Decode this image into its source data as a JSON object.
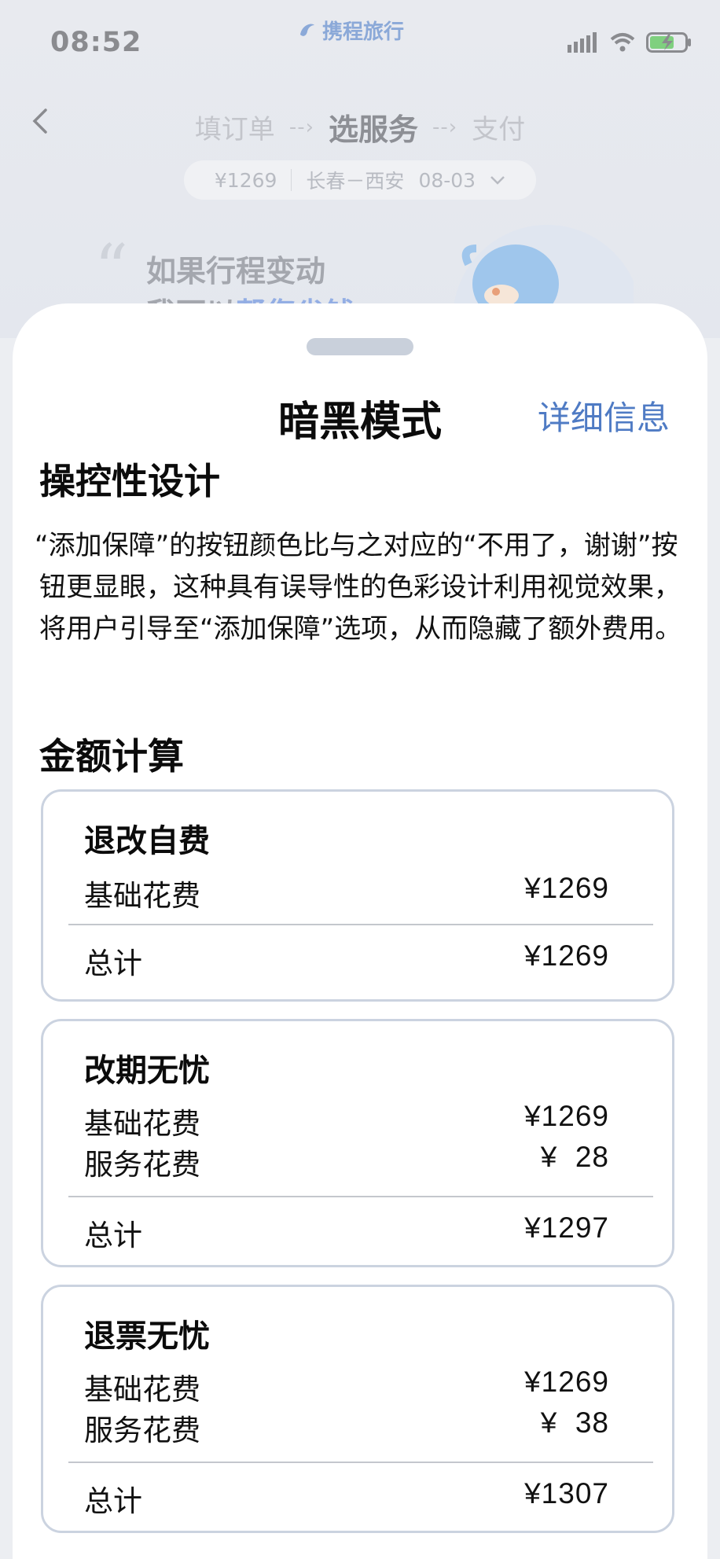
{
  "status_bar": {
    "time": "08:52",
    "brand": "携程旅行"
  },
  "nav": {
    "steps": [
      {
        "label": "填订单"
      },
      {
        "label": "选服务"
      },
      {
        "label": "支付"
      }
    ],
    "step_arrow": "--›"
  },
  "route": {
    "price": "¥1269",
    "cities": "长春－西安",
    "date": "08-03"
  },
  "hero": {
    "line1": "如果行程变动",
    "line2_prefix": "我可以",
    "line2_highlight": "帮您省钱"
  },
  "sheet": {
    "title": "暗黑模式",
    "detail_link": "详细信息",
    "section1_title": "操控性设计",
    "section1_desc": "“添加保障”的按钮颜色比与之对应的“不用了，谢谢”按钮更显眼，这种具有误导性的色彩设计利用视觉效果，将用户引导至“添加保障”选项，从而隐藏了额外费用。",
    "section2_title": "金额计算",
    "cards": [
      {
        "title": "退改自费",
        "rows": [
          {
            "label": "基础花费",
            "amount": "¥1269"
          }
        ],
        "total_label": "总计",
        "total_amount": "¥1269"
      },
      {
        "title": "改期无忧",
        "rows": [
          {
            "label": "基础花费",
            "amount": "¥1269"
          },
          {
            "label": "服务花费",
            "amount": "¥  28"
          }
        ],
        "total_label": "总计",
        "total_amount": "¥1297"
      },
      {
        "title": "退票无忧",
        "rows": [
          {
            "label": "基础花费",
            "amount": "¥1269"
          },
          {
            "label": "服务花费",
            "amount": "¥  38"
          }
        ],
        "total_label": "总计",
        "total_amount": "¥1307"
      }
    ]
  },
  "colors": {
    "link": "#4f7bc4",
    "card_border": "#cbd3e0",
    "handle": "#c9d0db"
  }
}
